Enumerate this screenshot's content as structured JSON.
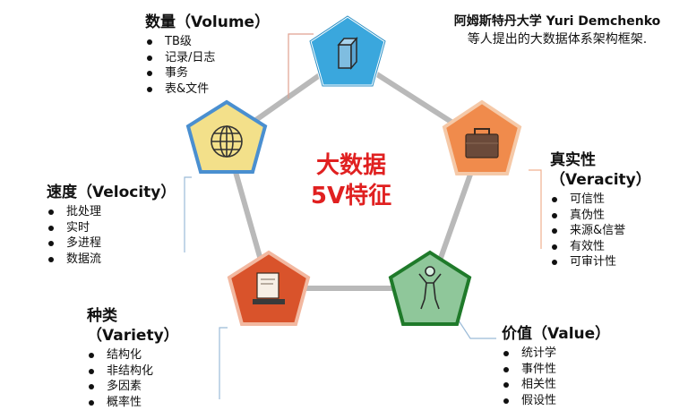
{
  "note": {
    "line1": "阿姆斯特丹大学 Yuri Demchenko",
    "line2": "等人提出的大数据体系架构框架."
  },
  "center_title": {
    "line1": "大数据",
    "line2": "5V特征"
  },
  "nodes": {
    "volume": {
      "title": "数量（Volume）",
      "items": [
        "TB级",
        "记录/日志",
        "事务",
        "表&文件"
      ],
      "color": "#3aa7dd",
      "icon": "cube-icon"
    },
    "velocity": {
      "title": "速度（Velocity）",
      "items": [
        "批处理",
        "实时",
        "多进程",
        "数据流"
      ],
      "color": "#f3e08a",
      "icon": "globe-icon"
    },
    "variety": {
      "title_line1": "种类",
      "title_line2": "（Variety）",
      "items": [
        "结构化",
        "非结构化",
        "多因素",
        "概率性"
      ],
      "color": "#d9532b",
      "icon": "computer-icon"
    },
    "value": {
      "title": "价值（Value）",
      "items": [
        "统计学",
        "事件性",
        "相关性",
        "假设性"
      ],
      "color": "#8fc79a",
      "icon": "person-icon"
    },
    "veracity": {
      "title_line1": "真实性",
      "title_line2": "（Veracity）",
      "items": [
        "可信性",
        "真伪性",
        "来源&信誉",
        "有效性",
        "可审计性"
      ],
      "color": "#f08b4c",
      "icon": "briefcase-icon"
    }
  }
}
